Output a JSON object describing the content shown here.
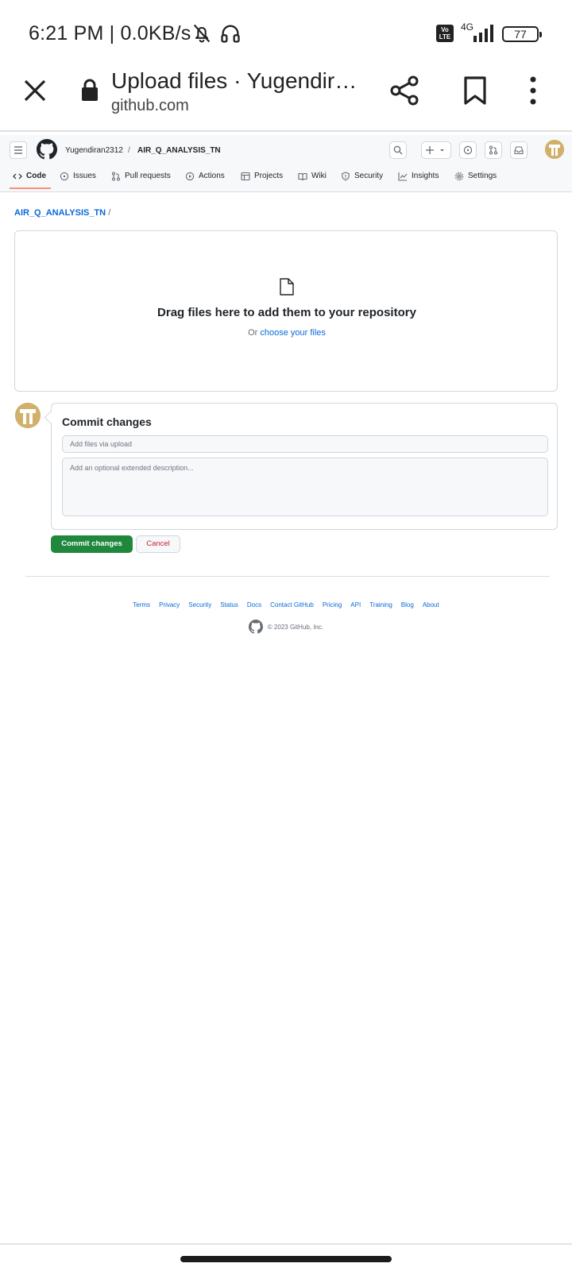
{
  "status_bar": {
    "time": "6:21 PM | 0.0KB/s",
    "volte": "Vo LTE",
    "network": "4G",
    "battery": "77"
  },
  "browser": {
    "title": "Upload files · Yugendir…",
    "url": "github.com"
  },
  "header": {
    "owner": "Yugendiran2312",
    "separator": "/",
    "repo": "AIR_Q_ANALYSIS_TN"
  },
  "repo_nav": {
    "tabs": [
      {
        "label": "Code",
        "icon": "code-icon"
      },
      {
        "label": "Issues",
        "icon": "issue-icon"
      },
      {
        "label": "Pull requests",
        "icon": "pull-request-icon"
      },
      {
        "label": "Actions",
        "icon": "actions-icon"
      },
      {
        "label": "Projects",
        "icon": "projects-icon"
      },
      {
        "label": "Wiki",
        "icon": "wiki-icon"
      },
      {
        "label": "Security",
        "icon": "shield-icon"
      },
      {
        "label": "Insights",
        "icon": "graph-icon"
      },
      {
        "label": "Settings",
        "icon": "gear-icon"
      }
    ],
    "active_tab": "Code"
  },
  "path": {
    "repo": "AIR_Q_ANALYSIS_TN",
    "separator": "/"
  },
  "dropzone": {
    "title": "Drag files here to add them to your repository",
    "prefix": "Or",
    "link": "choose your files"
  },
  "commit": {
    "title": "Commit changes",
    "summary_placeholder": "Add files via upload",
    "description_placeholder": "Add an optional extended description...",
    "commit_button": "Commit changes",
    "cancel_button": "Cancel"
  },
  "footer": {
    "links": [
      "Terms",
      "Privacy",
      "Security",
      "Status",
      "Docs",
      "Contact GitHub",
      "Pricing",
      "API",
      "Training",
      "Blog",
      "About"
    ],
    "copyright": "© 2023 GitHub, Inc."
  },
  "colors": {
    "link": "#0969da",
    "commit_green": "#1f883d",
    "cancel_red": "#cf222e",
    "tab_underline": "#fd8c73",
    "avatar": "#d1b06b"
  }
}
